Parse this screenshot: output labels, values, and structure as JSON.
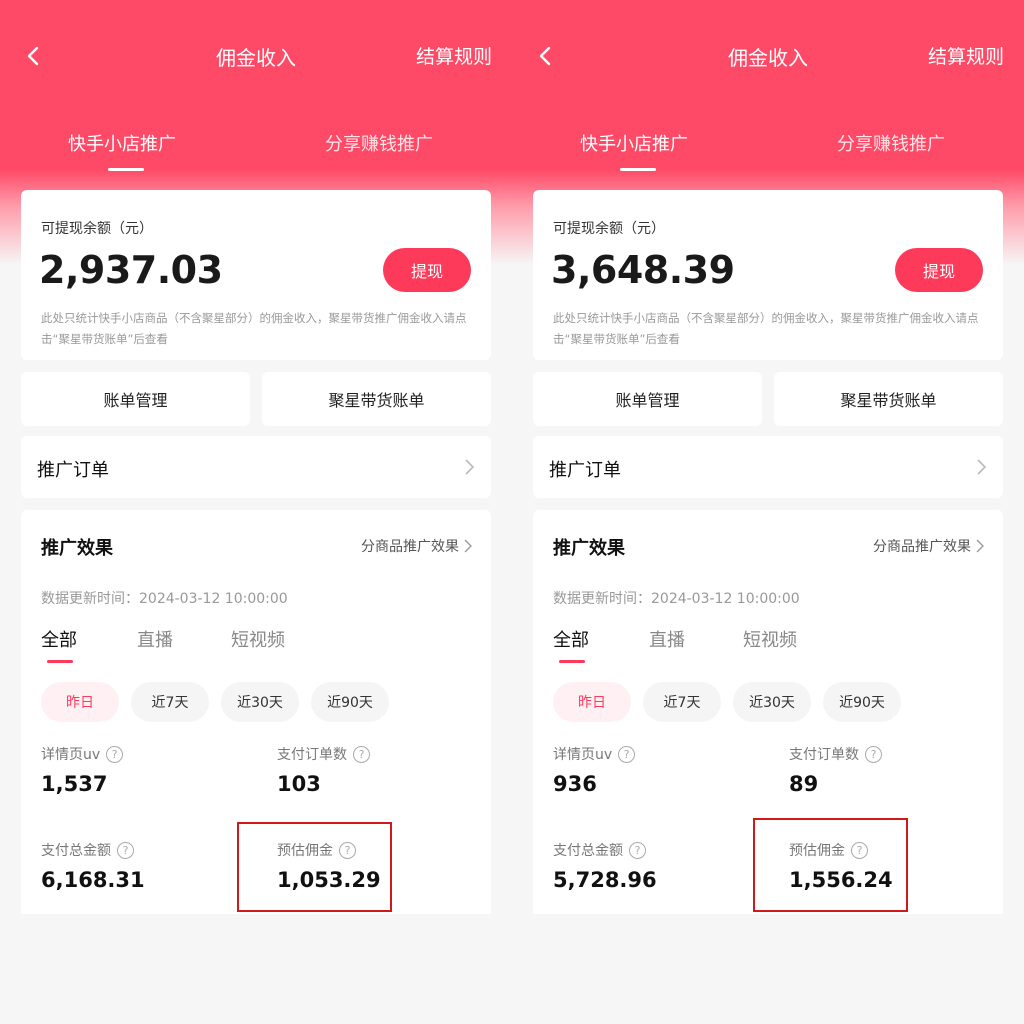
{
  "colors": {
    "accent": "#fe3a5b",
    "header": "#fe4a67",
    "highlight": "#d01a1a"
  },
  "screens": [
    {
      "nav": {
        "title": "佣金收入",
        "rule": "结算规则",
        "back_icon": "chevron-left-icon"
      },
      "tabs": [
        "快手小店推广",
        "分享赚钱推广"
      ],
      "balance": {
        "label": "可提现余额（元）",
        "value": "2,937.03",
        "withdraw": "提现",
        "note": "此处只统计快手小店商品（不含聚星部分）的佣金收入，聚星带货推广佣金收入请点击“聚星带货账单”后查看"
      },
      "buttons": {
        "bill": "账单管理",
        "juxing": "聚星带货账单"
      },
      "order": {
        "label": "推广订单"
      },
      "effect": {
        "title": "推广效果",
        "link": "分商品推广效果",
        "update_time": "数据更新时间：2024-03-12 10:00:00",
        "sub_tabs": [
          "全部",
          "直播",
          "短视频"
        ],
        "chips": [
          "昨日",
          "近7天",
          "近30天",
          "近90天"
        ],
        "metrics": [
          {
            "label": "详情页uv",
            "value": "1,537"
          },
          {
            "label": "支付订单数",
            "value": "103"
          },
          {
            "label": "支付总金额",
            "value": "6,168.31"
          },
          {
            "label": "预估佣金",
            "value": "1,053.29"
          }
        ]
      }
    },
    {
      "nav": {
        "title": "佣金收入",
        "rule": "结算规则",
        "back_icon": "chevron-left-icon"
      },
      "tabs": [
        "快手小店推广",
        "分享赚钱推广"
      ],
      "balance": {
        "label": "可提现余额（元）",
        "value": "3,648.39",
        "withdraw": "提现",
        "note": "此处只统计快手小店商品（不含聚星部分）的佣金收入，聚星带货推广佣金收入请点击“聚星带货账单”后查看"
      },
      "buttons": {
        "bill": "账单管理",
        "juxing": "聚星带货账单"
      },
      "order": {
        "label": "推广订单"
      },
      "effect": {
        "title": "推广效果",
        "link": "分商品推广效果",
        "update_time": "数据更新时间：2024-03-12 10:00:00",
        "sub_tabs": [
          "全部",
          "直播",
          "短视频"
        ],
        "chips": [
          "昨日",
          "近7天",
          "近30天",
          "近90天"
        ],
        "metrics": [
          {
            "label": "详情页uv",
            "value": "936"
          },
          {
            "label": "支付订单数",
            "value": "89"
          },
          {
            "label": "支付总金额",
            "value": "5,728.96"
          },
          {
            "label": "预估佣金",
            "value": "1,556.24"
          }
        ]
      }
    }
  ]
}
